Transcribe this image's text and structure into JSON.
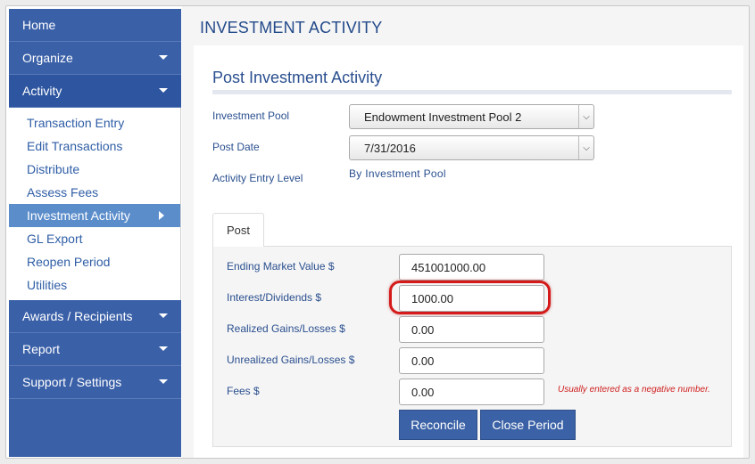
{
  "sidebar": {
    "home": "Home",
    "organize": "Organize",
    "activity": "Activity",
    "activity_items": [
      "Transaction Entry",
      "Edit Transactions",
      "Distribute",
      "Assess Fees",
      "Investment Activity",
      "GL Export",
      "Reopen Period",
      "Utilities"
    ],
    "awards": "Awards / Recipients",
    "report": "Report",
    "support": "Support / Settings"
  },
  "page": {
    "title": "INVESTMENT ACTIVITY",
    "section_title": "Post Investment Activity"
  },
  "form": {
    "investment_pool_label": "Investment Pool",
    "investment_pool_value": "Endowment Investment Pool 2",
    "post_date_label": "Post Date",
    "post_date_value": "7/31/2016",
    "entry_level_label": "Activity Entry Level",
    "entry_level_value": "By Investment Pool"
  },
  "tab": {
    "label": "Post"
  },
  "fields": {
    "ending_market_value_label": "Ending Market Value $",
    "ending_market_value": "451001000.00",
    "interest_dividends_label": "Interest/Dividends $",
    "interest_dividends": "1000.00",
    "realized_label": "Realized Gains/Losses $",
    "realized": "0.00",
    "unrealized_label": "Unrealized Gains/Losses $",
    "unrealized": "0.00",
    "fees_label": "Fees $",
    "fees": "0.00",
    "fees_hint": "Usually entered as a negative number."
  },
  "buttons": {
    "reconcile": "Reconcile",
    "close_period": "Close Period"
  },
  "colors": {
    "sidebar": "#3a60a8",
    "accent": "#2a4f8f",
    "highlight": "#d41a1a"
  }
}
